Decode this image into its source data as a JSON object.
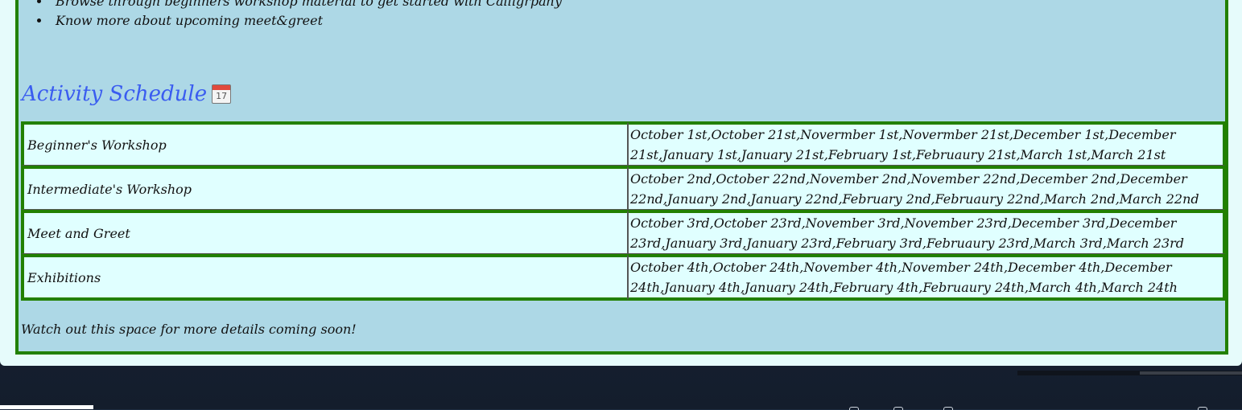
{
  "intro": {
    "bullets": [
      "Browse through beginners workshop material to get started with Calligrpahy",
      "Know more about upcoming meet&greet"
    ]
  },
  "schedule": {
    "heading": "Activity Schedule",
    "heading_icon": "calendar-icon",
    "heading_icon_text": "17",
    "rows": [
      {
        "activity": "Beginner's Workshop",
        "dates": "October 1st,October 21st,Novermber 1st,Novermber 21st,December 1st,December 21st,January 1st,January 21st,February 1st,Februaury 21st,March 1st,March 21st"
      },
      {
        "activity": "Intermediate's Workshop",
        "dates": "October 2nd,October 22nd,November 2nd,November 22nd,December 2nd,December 22nd,January 2nd,January 22nd,February 2nd,Februaury 22nd,March 2nd,March 22nd"
      },
      {
        "activity": "Meet and Greet",
        "dates": "October 3rd,October 23rd,November 3rd,November 23rd,December 3rd,December 23rd,January 3rd,January 23rd,February 3rd,Februaury 23rd,March 3rd,March 23rd"
      },
      {
        "activity": "Exhibitions",
        "dates": "October 4th,October 24th,November 4th,November 24th,December 4th,December 24th,January 4th,January 24th,February 4th,Februaury 24th,March 4th,March 24th"
      }
    ],
    "footer_note": "Watch out this space for more details coming soon!"
  },
  "colors": {
    "page_background": "#add8e6",
    "table_cell_background": "#e0ffff",
    "border_green": "#228000",
    "heading_blue": "#3a5cf0",
    "desktop_background": "#1c2a3e"
  }
}
